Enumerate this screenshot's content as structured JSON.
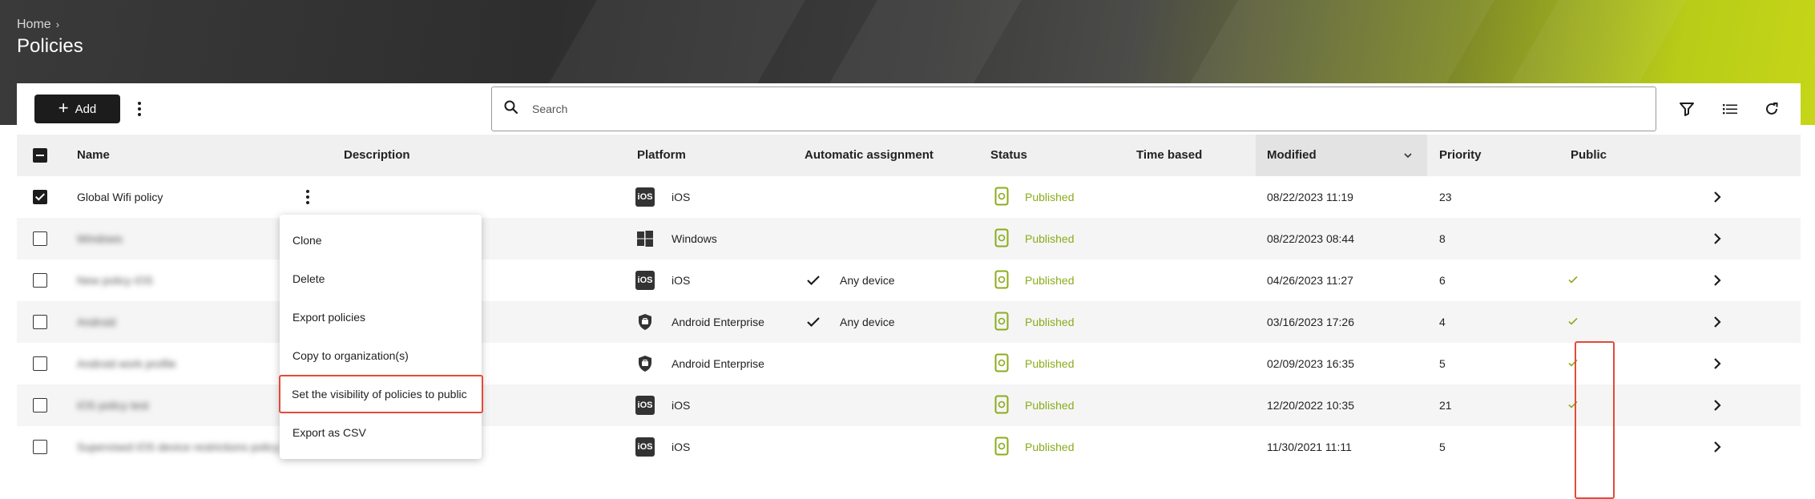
{
  "breadcrumb": {
    "home": "Home",
    "separator": "›"
  },
  "page_title": "Policies",
  "toolbar": {
    "add_label": "Add",
    "search_placeholder": "Search",
    "icons": [
      "filter-icon",
      "list-view-icon",
      "refresh-icon"
    ]
  },
  "columns": {
    "name": "Name",
    "description": "Description",
    "platform": "Platform",
    "automatic_assignment": "Automatic assignment",
    "status": "Status",
    "time_based": "Time based",
    "modified": "Modified",
    "priority": "Priority",
    "public": "Public"
  },
  "rows": [
    {
      "checked": true,
      "name": "Global Wifi policy",
      "platform": "iOS",
      "auto": "",
      "status": "Published",
      "modified": "08/22/2023 11:19",
      "priority": "23",
      "public": false
    },
    {
      "checked": false,
      "name": "Windows",
      "platform": "Windows",
      "auto": "",
      "status": "Published",
      "modified": "08/22/2023 08:44",
      "priority": "8",
      "public": false
    },
    {
      "checked": false,
      "name": "New policy iOS",
      "platform": "iOS",
      "auto": "Any device",
      "status": "Published",
      "modified": "04/26/2023 11:27",
      "priority": "6",
      "public": true
    },
    {
      "checked": false,
      "name": "Android",
      "platform": "Android Enterprise",
      "auto": "Any device",
      "status": "Published",
      "modified": "03/16/2023 17:26",
      "priority": "4",
      "public": true
    },
    {
      "checked": false,
      "name": "Android work profile",
      "platform": "Android Enterprise",
      "auto": "",
      "status": "Published",
      "modified": "02/09/2023 16:35",
      "priority": "5",
      "public": true
    },
    {
      "checked": false,
      "name": "iOS policy test",
      "platform": "iOS",
      "auto": "",
      "status": "Published",
      "modified": "12/20/2022 10:35",
      "priority": "21",
      "public": true
    },
    {
      "checked": false,
      "name": "Supervised iOS device restrictions policy",
      "platform": "iOS",
      "auto": "",
      "status": "Published",
      "modified": "11/30/2021 11:11",
      "priority": "5",
      "public": false
    }
  ],
  "context_menu": {
    "items": [
      "Clone",
      "Delete",
      "Export policies",
      "Copy to organization(s)",
      "Set the visibility of policies to public",
      "Export as CSV"
    ],
    "highlighted_index": 4
  },
  "colors": {
    "accent_green": "#8aac1a",
    "highlight_red": "#e24a3a",
    "primary_dark": "#1c1c1c"
  }
}
